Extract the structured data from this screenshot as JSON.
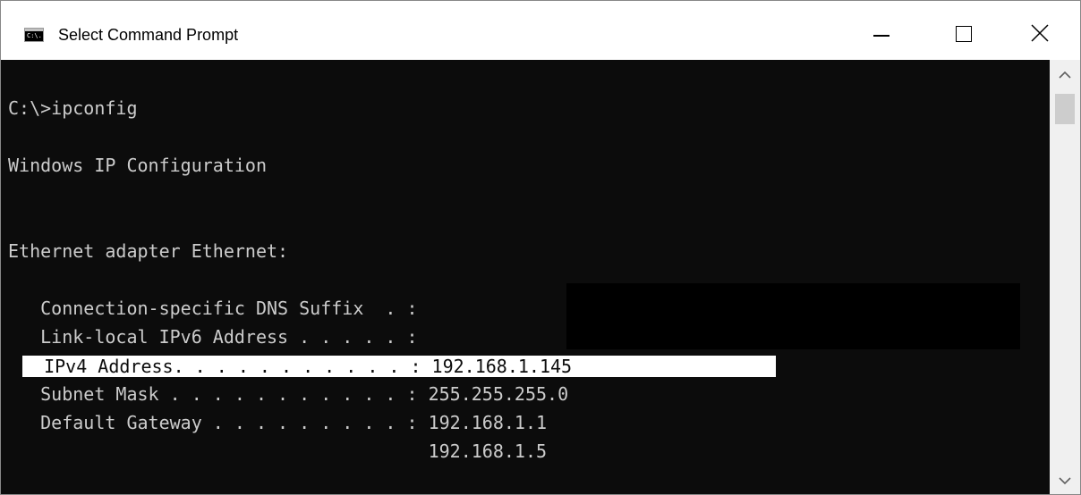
{
  "window": {
    "title": "Select Command Prompt",
    "icon": "cmd-icon",
    "icon_text": "C:\\."
  },
  "controls": {
    "minimize": "minimize-icon",
    "maximize": "maximize-icon",
    "close": "close-icon"
  },
  "console": {
    "lines": [
      {
        "text": "C:\\>ipconfig"
      },
      {
        "text": "Windows IP Configuration"
      },
      {
        "text": "Ethernet adapter Ethernet:"
      },
      {
        "text": "   Connection-specific DNS Suffix  . :"
      },
      {
        "text": "   Link-local IPv6 Address . . . . . :"
      },
      {
        "text": "  IPv4 Address. . . . . . . . . . . : 192.168.1.145"
      },
      {
        "text": "   Subnet Mask . . . . . . . . . . . : 255.255.255.0"
      },
      {
        "text": "   Default Gateway . . . . . . . . . : 192.168.1.1"
      },
      {
        "text": "                                       192.168.1.5"
      }
    ]
  },
  "colors": {
    "console_background": "#0c0c0c",
    "console_text": "#cccccc",
    "selection_background": "#ffffff",
    "selection_text": "#0c0c0c"
  }
}
